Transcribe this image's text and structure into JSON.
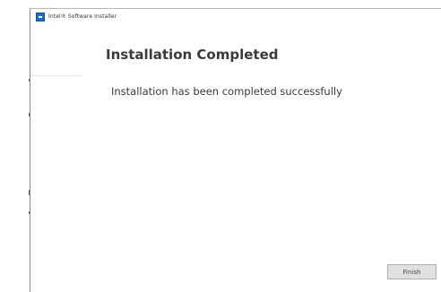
{
  "window": {
    "title": "Intel® Software Installer"
  },
  "page": {
    "heading": "Installation Completed",
    "message": "Installation has been completed successfully"
  },
  "buttons": {
    "finish_label": "Finish"
  },
  "icons": {
    "app_icon": "intel-installer-icon"
  },
  "colors": {
    "app_icon_blue": "#1e6fc8",
    "button_face": "#e1e1e1",
    "text": "#3a3a3a"
  }
}
